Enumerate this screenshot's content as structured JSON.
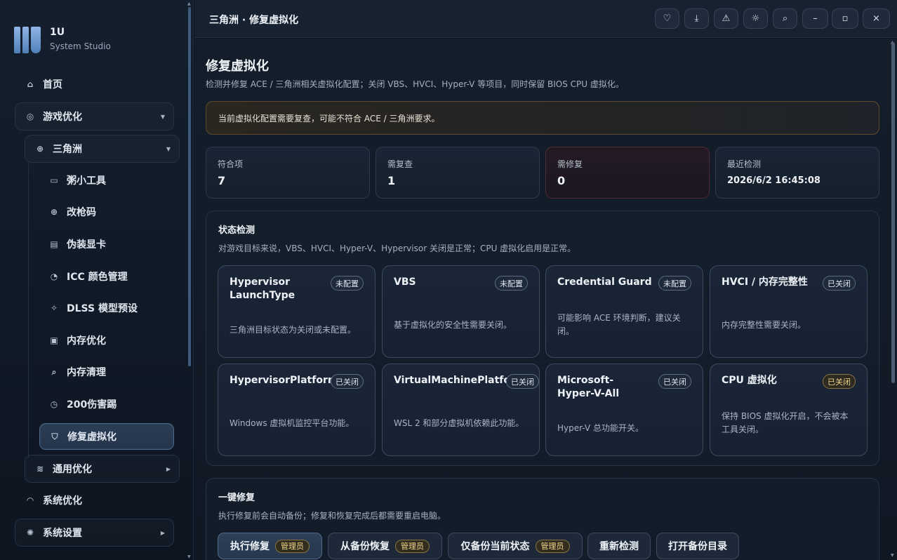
{
  "brand": {
    "name": "1U",
    "subtitle": "System Studio"
  },
  "sidebar": {
    "home": "首页",
    "game_opt": "游戏优化",
    "delta": "三角洲",
    "children": [
      {
        "label": "粥小工具",
        "icon": "toolbox-icon"
      },
      {
        "label": "改枪码",
        "icon": "crosshair-icon"
      },
      {
        "label": "伪装显卡",
        "icon": "gpu-icon"
      },
      {
        "label": "ICC 颜色管理",
        "icon": "palette-icon"
      },
      {
        "label": "DLSS 模型预设",
        "icon": "sparkle-icon"
      },
      {
        "label": "内存优化",
        "icon": "memory-icon"
      },
      {
        "label": "内存清理",
        "icon": "broom-icon"
      },
      {
        "label": "200伤害踢",
        "icon": "clock-icon"
      },
      {
        "label": "修复虚拟化",
        "icon": "shield-icon"
      }
    ],
    "general_opt": "通用优化",
    "system_opt": "系统优化",
    "system_settings": "系统设置"
  },
  "topbar": {
    "title": "三角洲 · 修复虚拟化"
  },
  "page": {
    "title": "修复虚拟化",
    "description": "检测并修复 ACE / 三角洲相关虚拟化配置；关闭 VBS、HVCI、Hyper-V 等项目，同时保留 BIOS CPU 虚拟化。",
    "alert": "当前虚拟化配置需要复查，可能不符合 ACE / 三角洲要求。"
  },
  "stats": [
    {
      "label": "符合项",
      "value": "7"
    },
    {
      "label": "需复查",
      "value": "1"
    },
    {
      "label": "需修复",
      "value": "0"
    },
    {
      "label": "最近检测",
      "value": "2026/6/2 16:45:08"
    }
  ],
  "status": {
    "title": "状态检测",
    "subtitle": "对游戏目标来说，VBS、HVCI、Hyper-V、Hypervisor 关闭是正常；CPU 虚拟化启用是正常。",
    "cards": [
      {
        "name": "Hypervisor LaunchType",
        "badge": "未配置",
        "desc": "三角洲目标状态为关闭或未配置。"
      },
      {
        "name": "VBS",
        "badge": "未配置",
        "desc": "基于虚拟化的安全性需要关闭。"
      },
      {
        "name": "Credential Guard",
        "badge": "未配置",
        "desc": "可能影响 ACE 环境判断，建议关闭。"
      },
      {
        "name": "HVCI / 内存完整性",
        "badge": "已关闭",
        "desc": "内存完整性需要关闭。"
      },
      {
        "name": "HypervisorPlatform",
        "badge": "已关闭",
        "desc": "Windows 虚拟机监控平台功能。"
      },
      {
        "name": "VirtualMachinePlatform",
        "badge": "已关闭",
        "desc": "WSL 2 和部分虚拟机依赖此功能。"
      },
      {
        "name": "Microsoft-Hyper-V-All",
        "badge": "已关闭",
        "desc": "Hyper-V 总功能开关。"
      },
      {
        "name": "CPU 虚拟化",
        "badge": "已关闭",
        "desc": "保持 BIOS 虚拟化开启，不会被本工具关闭。"
      }
    ]
  },
  "fix": {
    "title": "一键修复",
    "subtitle": "执行修复前会自动备份；修复和恢复完成后都需要重启电脑。",
    "admin_label": "管理员",
    "buttons": {
      "run": "执行修复",
      "restore": "从备份恢复",
      "backup": "仅备份当前状态",
      "recheck": "重新检测",
      "open_dir": "打开备份目录"
    }
  },
  "colors": {
    "accent": "#4f6a8a",
    "warning": "#f0d68a",
    "danger_border": "#4f2b33"
  }
}
